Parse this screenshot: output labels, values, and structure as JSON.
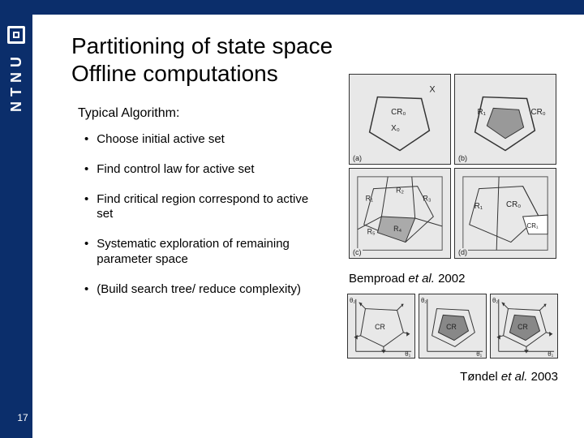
{
  "brand": "NTNU",
  "page_number": "17",
  "title_line1": "Partitioning of state space",
  "title_line2": "Offline computations",
  "subheading": "Typical Algorithm:",
  "bullets": [
    "Choose initial active set",
    "Find control law for active set",
    "Find critical region correspond to active set",
    "Systematic exploration of remaining parameter space",
    "(Build search tree/ reduce complexity)"
  ],
  "figure1": {
    "panel_labels": [
      "(a)",
      "(b)",
      "(c)",
      "(d)"
    ],
    "region_labels": [
      "X",
      "CR₀",
      "X₀",
      "R₁",
      "R₂",
      "R₃",
      "R₄",
      "R₅",
      "CR₁"
    ]
  },
  "citation1_author": "Bemproad",
  "citation1_rest": " et al. ",
  "citation1_year": "2002",
  "figure2": {
    "region_label": "CR",
    "axis_labels": [
      "θ₁",
      "θ₂"
    ]
  },
  "citation2_author": "Tøndel",
  "citation2_rest": " et al. ",
  "citation2_year": "2003"
}
